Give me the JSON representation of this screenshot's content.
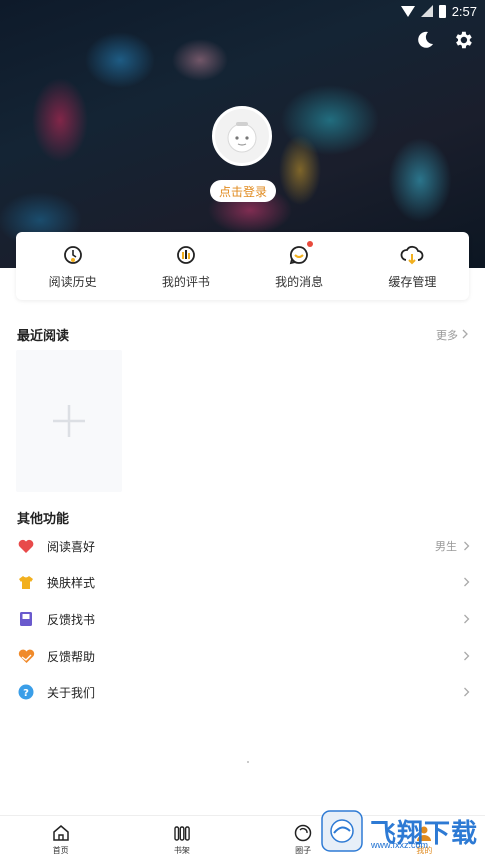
{
  "status_bar": {
    "time": "2:57"
  },
  "header": {
    "icons": [
      "moon-icon",
      "gear-icon"
    ],
    "login_label": "点击登录"
  },
  "quick_actions": [
    {
      "label": "阅读历史",
      "icon": "history-icon"
    },
    {
      "label": "我的评书",
      "icon": "comment-icon"
    },
    {
      "label": "我的消息",
      "icon": "message-icon",
      "badge": true
    },
    {
      "label": "缓存管理",
      "icon": "cloud-download-icon"
    }
  ],
  "recent": {
    "title": "最近阅读",
    "more_label": "更多"
  },
  "other": {
    "title": "其他功能",
    "items": [
      {
        "label": "阅读喜好",
        "value": "男生",
        "icon": "heart-icon",
        "color": "#e84a4a"
      },
      {
        "label": "换肤样式",
        "value": "",
        "icon": "shirt-icon",
        "color": "#f2b01e"
      },
      {
        "label": "反馈找书",
        "value": "",
        "icon": "book-icon",
        "color": "#6a5acd"
      },
      {
        "label": "反馈帮助",
        "value": "",
        "icon": "heart-hands-icon",
        "color": "#f08a2a"
      },
      {
        "label": "关于我们",
        "value": "",
        "icon": "question-icon",
        "color": "#3a9ee8"
      }
    ]
  },
  "bottom_nav": [
    {
      "label": "首页",
      "icon": "home-icon"
    },
    {
      "label": "书架",
      "icon": "bookshelf-icon"
    },
    {
      "label": "圈子",
      "icon": "circle-icon"
    },
    {
      "label": "我的",
      "icon": "profile-icon"
    }
  ],
  "watermark": {
    "text": "飞翔下载",
    "sub": "www.fxxz.com"
  },
  "colors": {
    "accent": "#e08a1e"
  }
}
